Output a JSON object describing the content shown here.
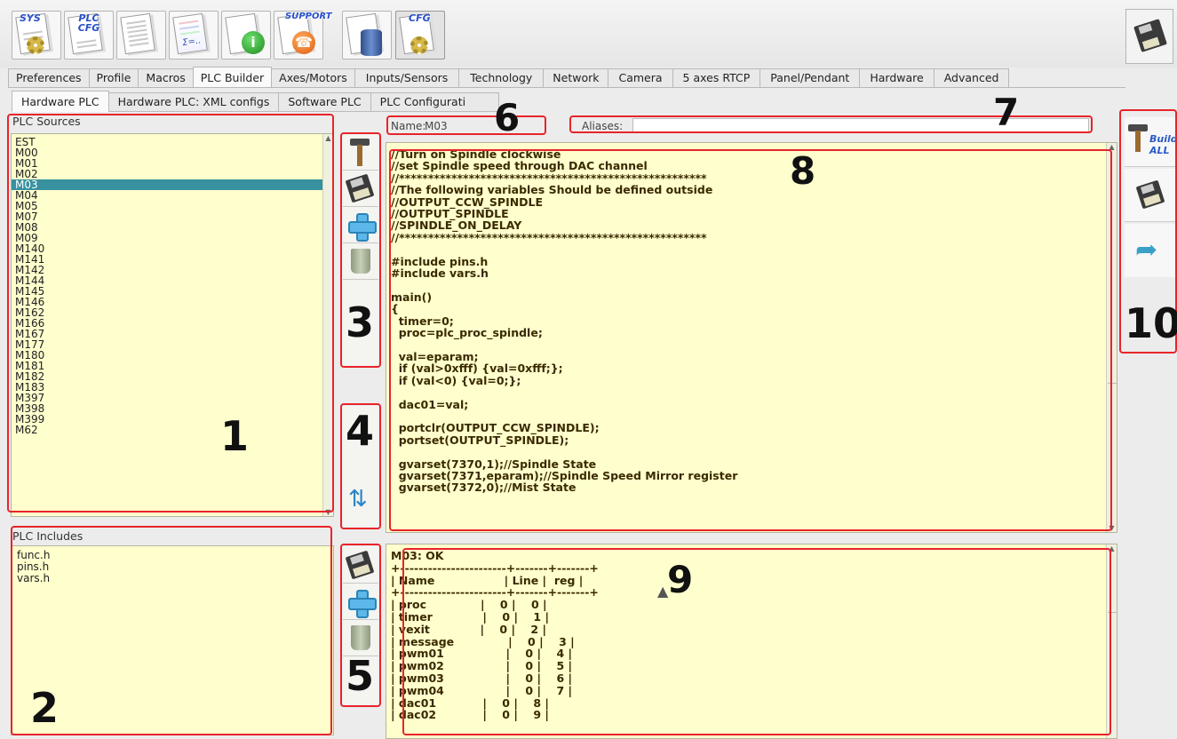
{
  "toolbar": {
    "buttons": [
      {
        "id": "sys",
        "label": "SYS"
      },
      {
        "id": "plc-cfg",
        "label": "PLC CFG"
      },
      {
        "id": "docs",
        "label": ""
      },
      {
        "id": "table",
        "label": ""
      },
      {
        "id": "info",
        "label": "i"
      },
      {
        "id": "support",
        "label": "SUPPORT"
      },
      {
        "id": "database",
        "label": ""
      },
      {
        "id": "cfg",
        "label": "CFG"
      }
    ]
  },
  "tabs": {
    "main": [
      "Preferences",
      "Profile",
      "Macros",
      "PLC Builder",
      "Axes/Motors",
      "Inputs/Sensors",
      "Technology",
      "Network",
      "Camera",
      "5 axes RTCP",
      "Panel/Pendant",
      "Hardware",
      "Advanced"
    ],
    "active_main": "PLC Builder",
    "sub": [
      "Hardware PLC",
      "Hardware PLC: XML configs",
      "Software PLC",
      "PLC Configurati"
    ],
    "active_sub": "Hardware PLC"
  },
  "sources": {
    "title": "PLC Sources",
    "items": [
      "EST",
      "M00",
      "M01",
      "M02",
      "M03",
      "M04",
      "M05",
      "M07",
      "M08",
      "M09",
      "M140",
      "M141",
      "M142",
      "M144",
      "M145",
      "M146",
      "M162",
      "M166",
      "M167",
      "M177",
      "M180",
      "M181",
      "M182",
      "M183",
      "M397",
      "M398",
      "M399",
      "M62"
    ],
    "selected": "M03"
  },
  "includes": {
    "title": "PLC Includes",
    "items": [
      "func.h",
      "pins.h",
      "vars.h"
    ]
  },
  "editor": {
    "name_label": "Name:",
    "name_value": "M03",
    "aliases_label": "Aliases:",
    "aliases_value": "",
    "code": "//Turn on Spindle clockwise\n//set Spindle speed through DAC channel\n//*****************************************************\n//The following variables Should be defined outside\n//OUTPUT_CCW_SPINDLE\n//OUTPUT_SPINDLE\n//SPINDLE_ON_DELAY\n//*****************************************************\n\n#include pins.h\n#include vars.h\n\nmain()\n{\n  timer=0;\n  proc=plc_proc_spindle;\n\n  val=eparam;\n  if (val>0xfff) {val=0xfff;};\n  if (val<0) {val=0;};\n\n  dac01=val;\n\n  portclr(OUTPUT_CCW_SPINDLE);\n  portset(OUTPUT_SPINDLE);\n\n  gvarset(7370,1);//Spindle State\n  gvarset(7371,eparam);//Spindle Speed Mirror register\n  gvarset(7372,0);//Mist State"
  },
  "output": {
    "text": "M03: OK\n+-----------------------+-------+-------+\n| Name                  | Line |  reg |\n+-----------------------+-------+-------+\n| proc              |    0 |    0 |\n| timer             |    0 |    1 |\n| vexit             |    0 |    2 |\n| message              |    0 |    3 |\n| pwm01                |    0 |    4 |\n| pwm02                |    0 |    5 |\n| pwm03                |    0 |    6 |\n| pwm04                |    0 |    7 |\n| dac01            |    0 |    8 |\n| dac02            |    0 |    9 |"
  },
  "right_panel": {
    "build_all_label": "Build ALL"
  },
  "annotations": [
    "1",
    "2",
    "3",
    "4",
    "5",
    "6",
    "7",
    "8",
    "9",
    "10"
  ],
  "colors": {
    "panel_bg": "#fffecd",
    "selection": "#37919f",
    "annotation_red": "#e8242a"
  }
}
